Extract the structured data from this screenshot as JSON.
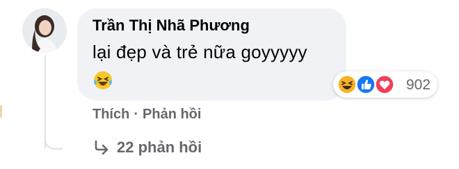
{
  "comment": {
    "author": "Trần Thị Nhã Phương",
    "text": "lại đẹp và trẻ nữa goyyyyy",
    "emoji": "laughing-with-tears-emoji",
    "reactions": {
      "icons": [
        "haha-reaction-icon",
        "like-reaction-icon",
        "love-reaction-icon"
      ],
      "count": "902"
    },
    "actions": {
      "like_label": "Thích",
      "separator": "·",
      "reply_label": "Phản hồi"
    },
    "replies_label": "22 phản hồi"
  },
  "colors": {
    "bubble": "#f0f2f5",
    "text": "#050505",
    "secondary_text": "#65676b",
    "like_blue": "#1877f2",
    "love_red": "#f33e58",
    "haha_yellow": "#f7b125"
  }
}
